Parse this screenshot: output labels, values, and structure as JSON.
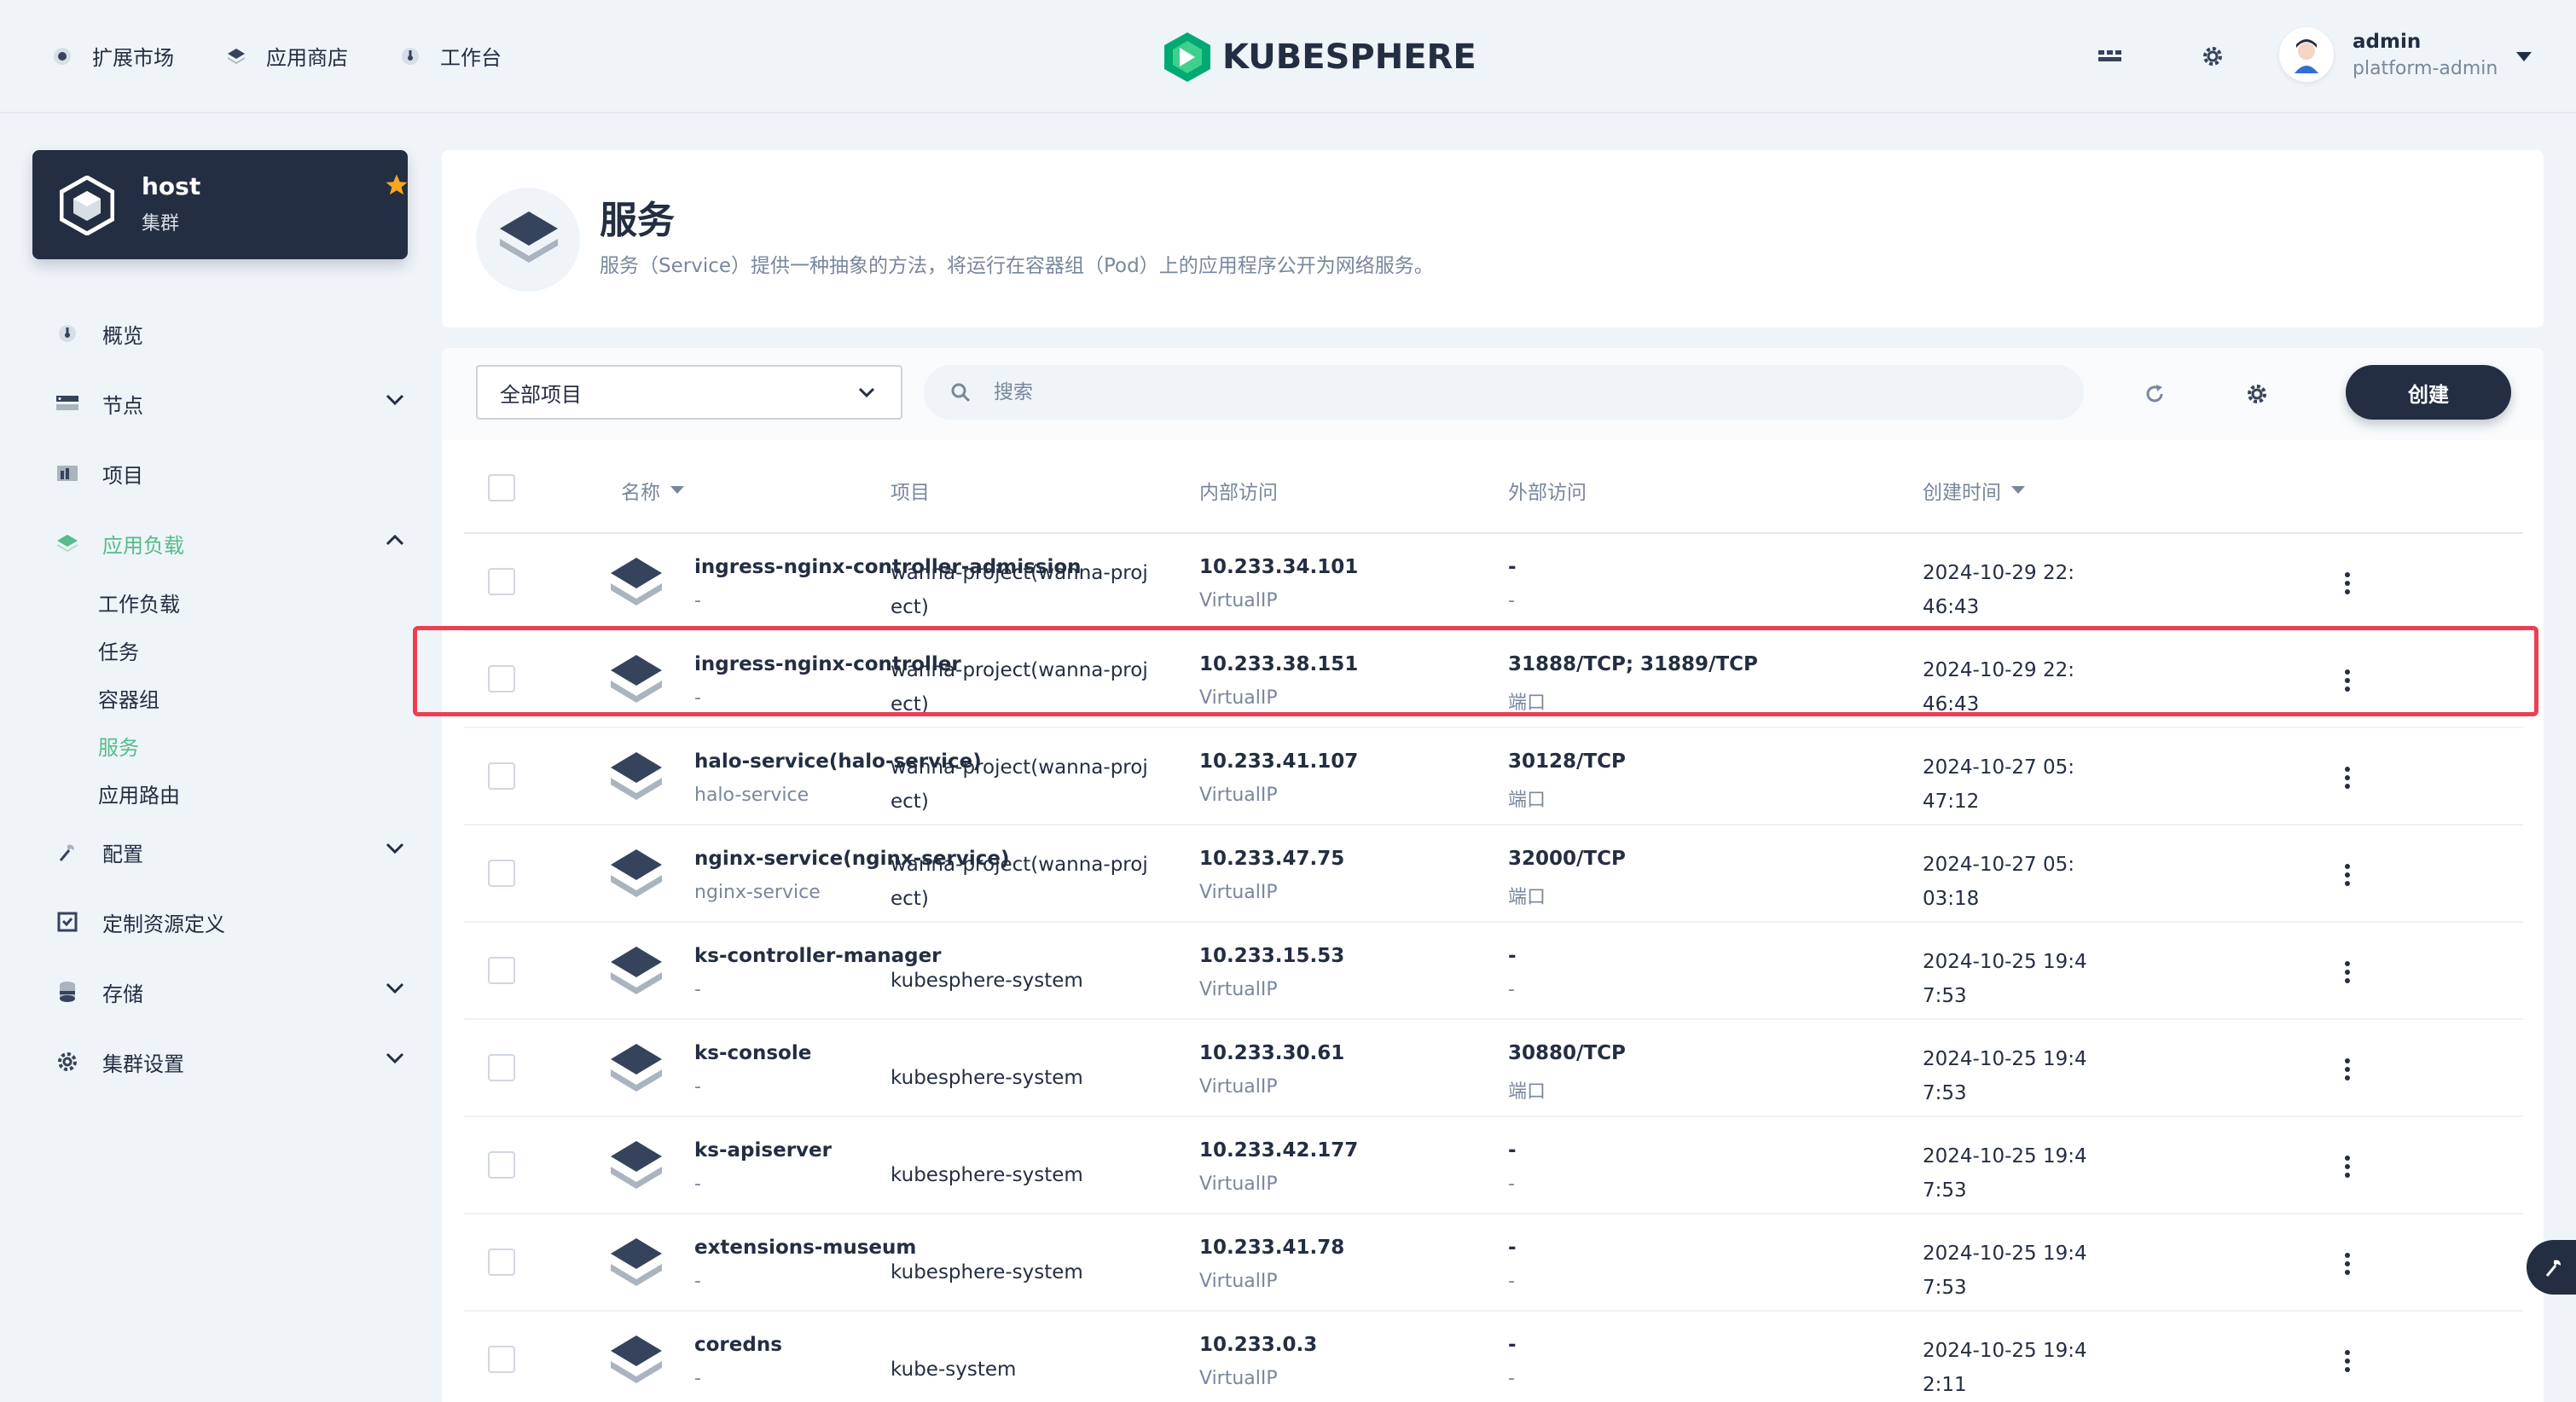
{
  "topnav": {
    "items": [
      {
        "label": "扩展市场",
        "icon": "puzzle-icon"
      },
      {
        "label": "应用商店",
        "icon": "store-icon"
      },
      {
        "label": "工作台",
        "icon": "dashboard-icon"
      }
    ],
    "brand": "KUBESPHERE"
  },
  "user": {
    "name": "admin",
    "role": "platform-admin"
  },
  "cluster": {
    "name": "host",
    "type": "集群"
  },
  "sidebar": {
    "items": [
      {
        "label": "概览",
        "icon": "overview-icon"
      },
      {
        "label": "节点",
        "icon": "nodes-icon"
      },
      {
        "label": "项目",
        "icon": "project-icon"
      },
      {
        "label": "应用负载",
        "icon": "workload-icon"
      },
      {
        "label": "配置",
        "icon": "config-icon"
      },
      {
        "label": "定制资源定义",
        "icon": "crd-icon"
      },
      {
        "label": "存储",
        "icon": "storage-icon"
      },
      {
        "label": "集群设置",
        "icon": "cluster-settings-icon"
      }
    ],
    "sub_items": [
      "工作负载",
      "任务",
      "容器组",
      "服务",
      "应用路由"
    ]
  },
  "page": {
    "title": "服务",
    "description": "服务（Service）提供一种抽象的方法，将运行在容器组（Pod）上的应用程序公开为网络服务。"
  },
  "toolbar": {
    "project_select": "全部项目",
    "search_placeholder": "搜索",
    "create_label": "创建"
  },
  "table": {
    "headers": {
      "name": "名称",
      "project": "项目",
      "internal": "内部访问",
      "external": "外部访问",
      "created": "创建时间"
    },
    "rows": [
      {
        "name": "ingress-nginx-controller-admission",
        "sub": "-",
        "project1": "wanna-project(wanna-proj",
        "project2": "ect)",
        "ip": "10.233.34.101",
        "ip_type": "VirtualIP",
        "ext": "-",
        "ext_sub": "-",
        "time1": "2024-10-29 22:",
        "time2": "46:43"
      },
      {
        "name": "ingress-nginx-controller",
        "sub": "-",
        "project1": "wanna-project(wanna-proj",
        "project2": "ect)",
        "ip": "10.233.38.151",
        "ip_type": "VirtualIP",
        "ext": "31888/TCP; 31889/TCP",
        "ext_sub": "端口",
        "time1": "2024-10-29 22:",
        "time2": "46:43"
      },
      {
        "name": "halo-service(halo-service)",
        "sub": "halo-service",
        "project1": "wanna-project(wanna-proj",
        "project2": "ect)",
        "ip": "10.233.41.107",
        "ip_type": "VirtualIP",
        "ext": "30128/TCP",
        "ext_sub": "端口",
        "time1": "2024-10-27 05:",
        "time2": "47:12"
      },
      {
        "name": "nginx-service(nginx-service)",
        "sub": "nginx-service",
        "project1": "wanna-project(wanna-proj",
        "project2": "ect)",
        "ip": "10.233.47.75",
        "ip_type": "VirtualIP",
        "ext": "32000/TCP",
        "ext_sub": "端口",
        "time1": "2024-10-27 05:",
        "time2": "03:18"
      },
      {
        "name": "ks-controller-manager",
        "sub": "-",
        "project1": "kubesphere-system",
        "project2": "",
        "ip": "10.233.15.53",
        "ip_type": "VirtualIP",
        "ext": "-",
        "ext_sub": "-",
        "time1": "2024-10-25 19:4",
        "time2": "7:53"
      },
      {
        "name": "ks-console",
        "sub": "-",
        "project1": "kubesphere-system",
        "project2": "",
        "ip": "10.233.30.61",
        "ip_type": "VirtualIP",
        "ext": "30880/TCP",
        "ext_sub": "端口",
        "time1": "2024-10-25 19:4",
        "time2": "7:53"
      },
      {
        "name": "ks-apiserver",
        "sub": "-",
        "project1": "kubesphere-system",
        "project2": "",
        "ip": "10.233.42.177",
        "ip_type": "VirtualIP",
        "ext": "-",
        "ext_sub": "-",
        "time1": "2024-10-25 19:4",
        "time2": "7:53"
      },
      {
        "name": "extensions-museum",
        "sub": "-",
        "project1": "kubesphere-system",
        "project2": "",
        "ip": "10.233.41.78",
        "ip_type": "VirtualIP",
        "ext": "-",
        "ext_sub": "-",
        "time1": "2024-10-25 19:4",
        "time2": "7:53"
      },
      {
        "name": "coredns",
        "sub": "-",
        "project1": "kube-system",
        "project2": "",
        "ip": "10.233.0.3",
        "ip_type": "VirtualIP",
        "ext": "-",
        "ext_sub": "-",
        "time1": "2024-10-25 19:4",
        "time2": "2:11"
      }
    ]
  },
  "colors": {
    "accent": "#55bc8a",
    "dark": "#242e42",
    "highlight": "#ee3e52",
    "star": "#f5a623"
  }
}
